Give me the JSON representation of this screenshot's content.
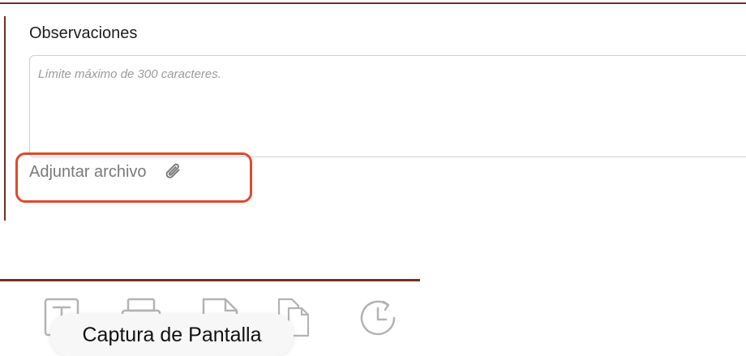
{
  "form": {
    "observaciones_label": "Observaciones",
    "observaciones_placeholder": "Límite máximo de 300 caracteres.",
    "observaciones_value": "",
    "adjuntar_label": "Adjuntar archivo"
  },
  "toolbar": {
    "items": [
      {
        "icon": "text-document-icon"
      },
      {
        "icon": "printer-icon"
      },
      {
        "icon": "pdf-file-icon"
      },
      {
        "icon": "copy-files-icon"
      },
      {
        "icon": "history-clock-icon"
      }
    ],
    "tooltip": "Captura de Pantalla"
  },
  "colors": {
    "accent": "#6e2e26",
    "highlight": "#e0492c",
    "icon_gray": "#b3b3b3"
  }
}
